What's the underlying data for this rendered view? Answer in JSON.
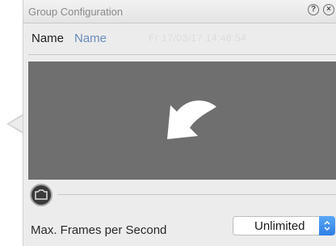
{
  "window": {
    "title": "Group Configuration",
    "help_icon": "help-icon",
    "close_icon": "close-icon"
  },
  "name_row": {
    "label": "Name",
    "value": "Name",
    "timestamp": "Fr 17/03/17 14:48:54"
  },
  "preview": {
    "icon": "curved-arrow-icon",
    "background": "#6f6f6f"
  },
  "camera_button": {
    "icon": "camera-icon"
  },
  "fps": {
    "label": "Max. Frames per Second",
    "selected": "Unlimited",
    "stepper_icon": "stepper-icon",
    "accent": "#3b8ff0"
  }
}
